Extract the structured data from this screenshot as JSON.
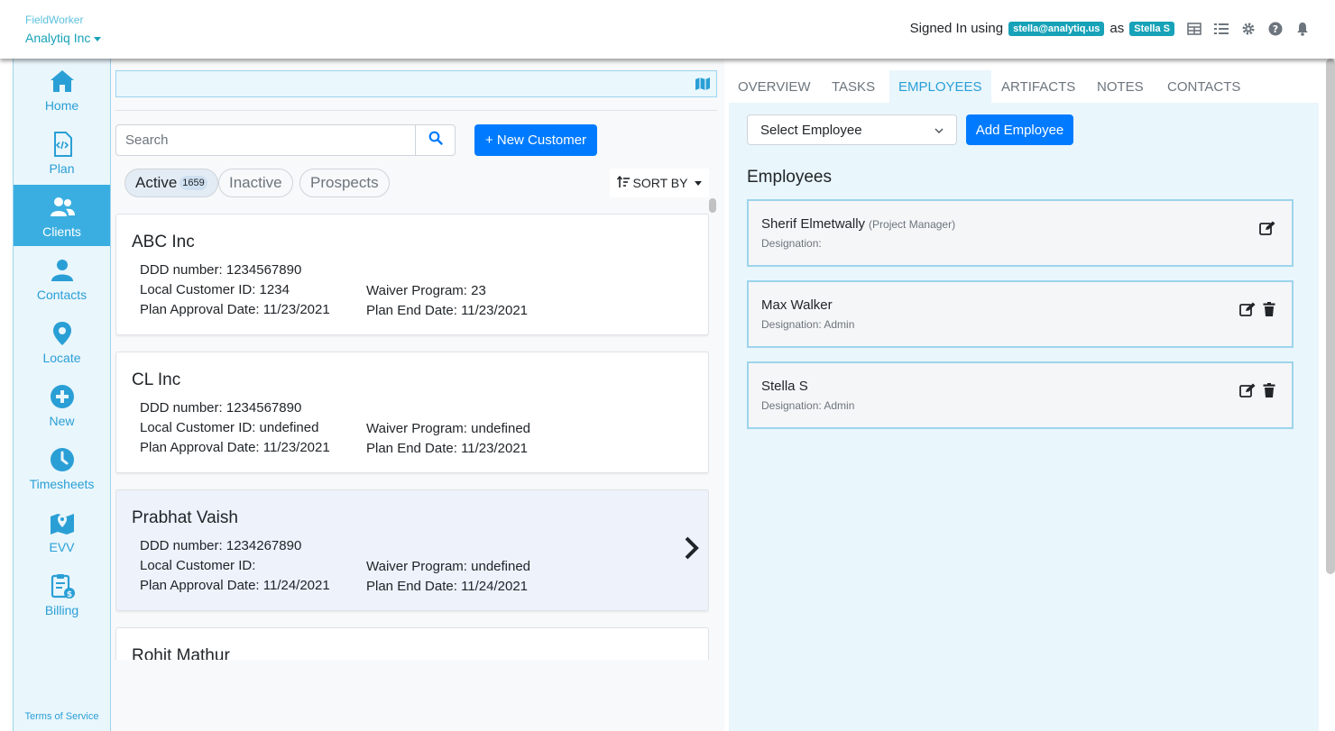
{
  "app": {
    "product_name": "FieldWorker",
    "org_name": "Analytiq Inc"
  },
  "account": {
    "signed_in_prefix": "Signed In using",
    "email": "stella@analytiq.us",
    "as_text": "as",
    "user_name": "Stella S"
  },
  "header_icons": [
    "table-icon",
    "list-icon",
    "gear-icon",
    "help-icon",
    "bell-icon"
  ],
  "sidebar": {
    "items": [
      {
        "label": "Home",
        "icon": "home-icon"
      },
      {
        "label": "Plan",
        "icon": "code-file-icon"
      },
      {
        "label": "Clients",
        "icon": "users-icon"
      },
      {
        "label": "Contacts",
        "icon": "user-icon"
      },
      {
        "label": "Locate",
        "icon": "map-marker-icon"
      },
      {
        "label": "New",
        "icon": "plus-circle-icon"
      },
      {
        "label": "Timesheets",
        "icon": "clock-icon"
      },
      {
        "label": "EVV",
        "icon": "map-icon"
      },
      {
        "label": "Billing",
        "icon": "billing-clipboard-icon"
      }
    ],
    "active": "Clients",
    "footer_link": "Terms of Service"
  },
  "customers": {
    "search_placeholder": "Search",
    "new_button": "+ New Customer",
    "filters": [
      {
        "label": "Active",
        "count": "1659"
      },
      {
        "label": "Inactive"
      },
      {
        "label": "Prospects"
      }
    ],
    "sort_label": "SORT BY",
    "list": [
      {
        "name": "ABC Inc",
        "ddd": "DDD number: 1234567890",
        "local_id": "Local Customer ID: 1234",
        "waiver": "Waiver Program: 23",
        "approval": "Plan Approval Date: 11/23/2021",
        "end": "Plan End Date: 11/23/2021"
      },
      {
        "name": "CL Inc",
        "ddd": "DDD number: 1234567890",
        "local_id": "Local Customer ID: undefined",
        "waiver": "Waiver Program: undefined",
        "approval": "Plan Approval Date: 11/23/2021",
        "end": "Plan End Date: 11/23/2021"
      },
      {
        "name": "Prabhat Vaish",
        "ddd": "DDD number: 1234267890",
        "local_id": "Local Customer ID:",
        "waiver": "Waiver Program: undefined",
        "approval": "Plan Approval Date: 11/24/2021",
        "end": "Plan End Date: 11/24/2021"
      },
      {
        "name": "Rohit Mathur"
      }
    ]
  },
  "detail": {
    "tabs": [
      "OVERVIEW",
      "TASKS",
      "EMPLOYEES",
      "ARTIFACTS",
      "NOTES",
      "CONTACTS"
    ],
    "active_tab": "EMPLOYEES",
    "select_employee": "Select Employee",
    "add_employee": "Add Employee",
    "employees_heading": "Employees",
    "employees": [
      {
        "name": "Sherif Elmetwally",
        "role": "(Project Manager)",
        "designation": "Designation:"
      },
      {
        "name": "Max Walker",
        "role": "",
        "designation": "Designation: Admin"
      },
      {
        "name": "Stella S",
        "role": "",
        "designation": "Designation: Admin"
      }
    ]
  },
  "colors": {
    "accent": "#2a9fd6",
    "primary_button": "#007bff",
    "pill": "#17a2b8"
  }
}
